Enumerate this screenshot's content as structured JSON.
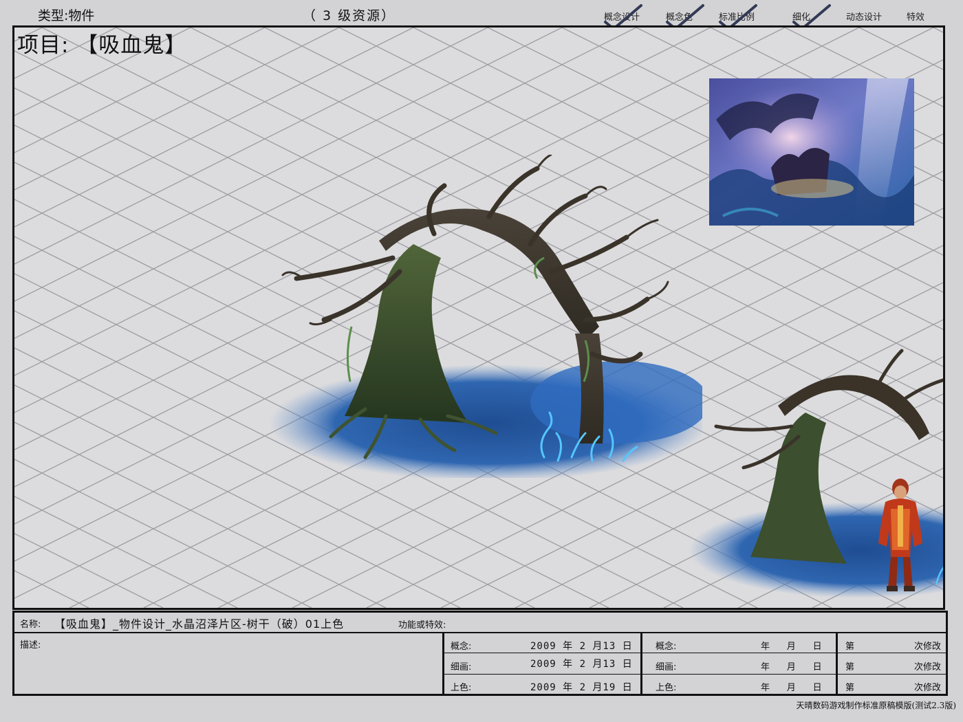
{
  "header": {
    "type_label": "类型:物件",
    "level_label": "（ 3  级资源）",
    "stages": [
      "概念设计",
      "概念色",
      "标准比例",
      "细化",
      "动态设计",
      "特效"
    ],
    "checked_stages": [
      "概念设计",
      "概念色",
      "标准比例",
      "细化"
    ]
  },
  "project": {
    "title": "项目: 【吸血鬼】"
  },
  "artwork": {
    "main_object": "dead-tree-arch-icon",
    "preview_object": "dead-tree-arch-small-icon",
    "scale_reference": "red-armored-character-icon",
    "concept_thumbnail": "concept-painting-icon",
    "palette": {
      "bark": "#3b3228",
      "moss": "#4d6a3a",
      "water": "#2c5a9a",
      "glow": "#55c6ff",
      "armor": "#c0391b"
    }
  },
  "info": {
    "name_label": "名称:",
    "name_value": "【吸血鬼】_物件设计_水晶沼泽片区-树干（破）01上色",
    "effects_label": "功能或特效:",
    "desc_label": "描述:",
    "concept_label": "概念:",
    "concept_date": "2009 年 2  月13 日",
    "detail_label": "细画:",
    "detail_date": "2009 年 2  月13 日",
    "color_label": "上色:",
    "color_date": "2009 年 2  月19 日",
    "concept_label_2": "概念:",
    "detail_label_2": "细画:",
    "color_label_2": "上色:",
    "empty_date": "年      月      日",
    "revision_prefix": "第",
    "revision_suffix": "次修改"
  },
  "footer": {
    "text": "天晴数码游戏制作标准原稿模版(测试2.3版)"
  }
}
